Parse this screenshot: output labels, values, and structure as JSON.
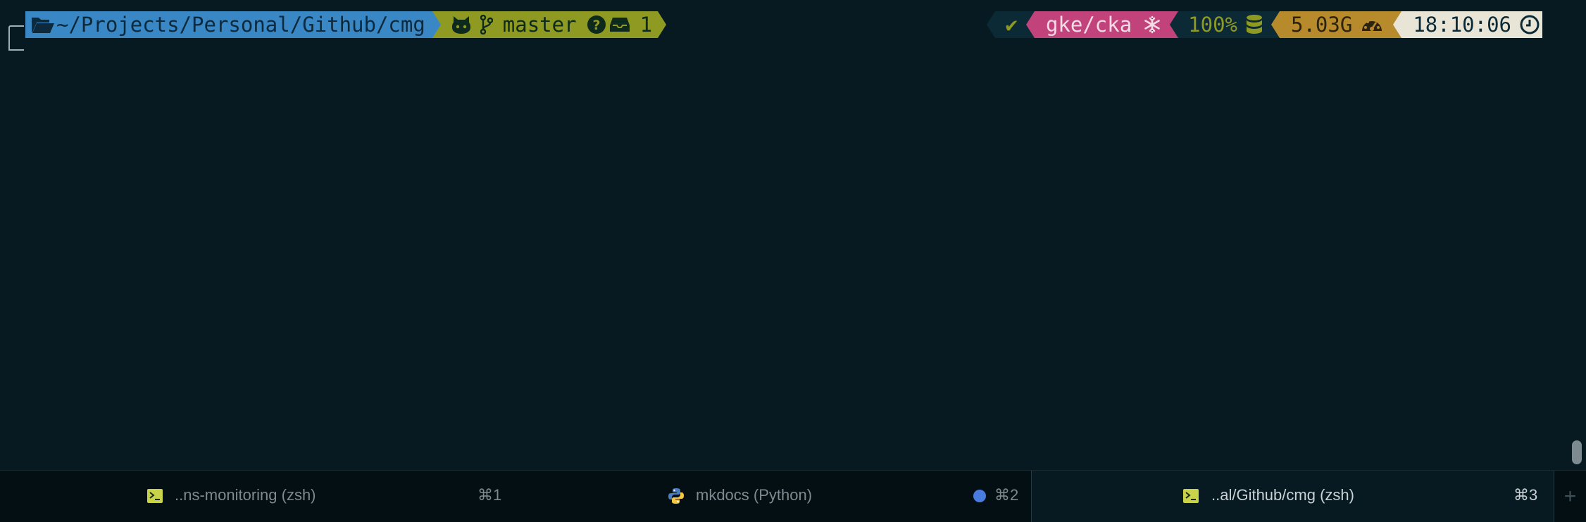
{
  "prompt": {
    "path": "~/Projects/Personal/Github/cmg",
    "branch": "master",
    "stash_count": "1",
    "status_check": "✔",
    "kube_context": "gke/cka",
    "battery": "100%",
    "memory": "5.03G",
    "time": "18:10:06"
  },
  "colors": {
    "background": "#071a21",
    "path_segment": "#3a87c5",
    "git_segment": "#8f9a23",
    "kube_segment": "#c2437b",
    "battery_segment": "#0c2a36",
    "memory_segment": "#b78a2b",
    "time_segment": "#e8e4d6"
  },
  "tabs": [
    {
      "icon": "terminal-icon",
      "title": "..ns-monitoring (zsh)",
      "shortcut": "⌘1",
      "active": false
    },
    {
      "icon": "python-icon",
      "title": "mkdocs (Python)",
      "shortcut": "⌘2",
      "active": false,
      "activity": true
    },
    {
      "icon": "terminal-icon",
      "title": "..al/Github/cmg (zsh)",
      "shortcut": "⌘3",
      "active": true
    }
  ],
  "new_tab_label": "+"
}
